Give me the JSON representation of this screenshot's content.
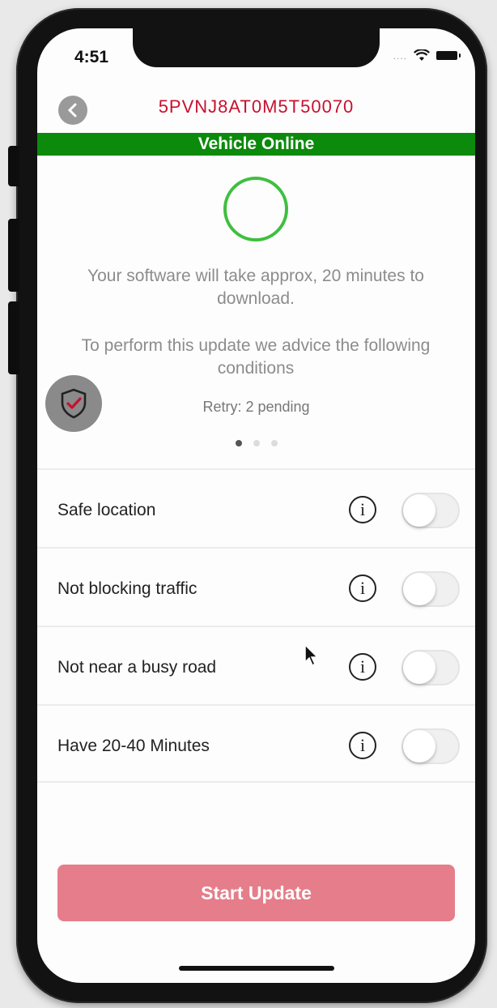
{
  "status_bar": {
    "time": "4:51",
    "dots": "....",
    "icons": [
      "wifi-icon",
      "battery-icon"
    ]
  },
  "header": {
    "vin": "5PVNJ8AT0M5T50070",
    "back_icon": "chevron-left-icon"
  },
  "banner": {
    "text": "Vehicle Online",
    "color": "#0b8a0b"
  },
  "info": {
    "download_text": "Your software will take approx, 20 minutes to download.",
    "conditions_text": "To perform this update we advice the following conditions",
    "retry_text": "Retry: 2 pending"
  },
  "pagination": {
    "count": 3,
    "active": 0
  },
  "conditions": [
    {
      "label": "Safe location",
      "enabled": false
    },
    {
      "label": "Not blocking traffic",
      "enabled": false
    },
    {
      "label": "Not near a busy road",
      "enabled": false
    },
    {
      "label": "Have 20-40 Minutes",
      "enabled": false
    }
  ],
  "actions": {
    "start_label": "Start Update",
    "start_color": "#e57e8a"
  },
  "colors": {
    "brand_red": "#c8102e",
    "success_green": "#3fbf3f"
  }
}
